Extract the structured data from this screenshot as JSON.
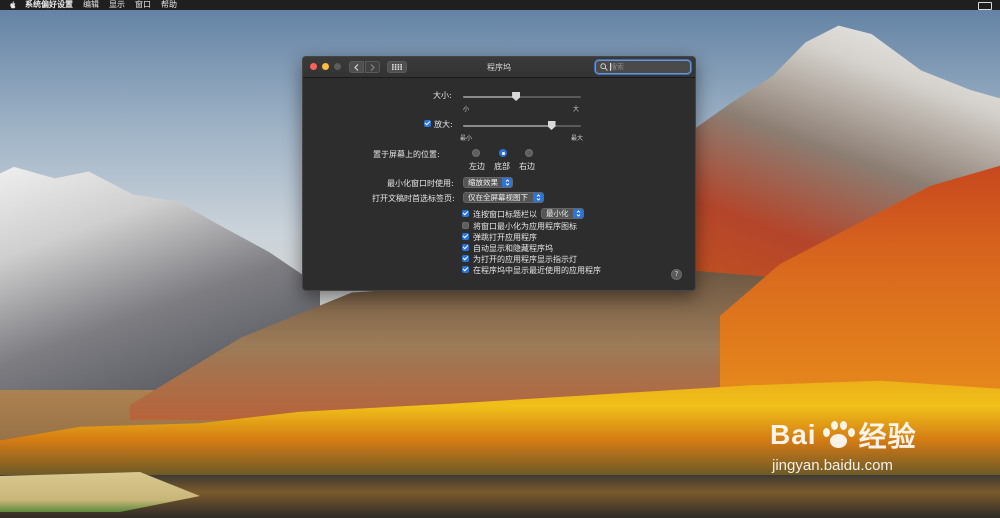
{
  "menubar": {
    "app": "系统偏好设置",
    "items": [
      "编辑",
      "显示",
      "窗口",
      "帮助"
    ]
  },
  "window": {
    "title": "程序坞",
    "search_placeholder": "搜索"
  },
  "dock": {
    "size_label": "大小:",
    "size_min": "小",
    "size_max": "大",
    "size_value": 0.45,
    "magnify_label": "放大:",
    "magnify_checked": true,
    "magnify_min": "最小",
    "magnify_max": "最大",
    "magnify_value": 0.75,
    "position_label": "置于屏幕上的位置:",
    "positions": [
      {
        "label": "左边",
        "selected": false
      },
      {
        "label": "底部",
        "selected": true
      },
      {
        "label": "右边",
        "selected": false
      }
    ],
    "minimize_label": "最小化窗口时使用:",
    "minimize_value": "缩放效果",
    "tabs_label": "打开文稿时首选标签页:",
    "tabs_value": "仅在全屏幕视图下",
    "options": [
      {
        "label": "连按窗口标题栏以",
        "checked": true,
        "select": "最小化"
      },
      {
        "label": "将窗口最小化为应用程序图标",
        "checked": false
      },
      {
        "label": "弹跳打开应用程序",
        "checked": true
      },
      {
        "label": "自动显示和隐藏程序坞",
        "checked": true
      },
      {
        "label": "为打开的应用程序显示指示灯",
        "checked": true
      },
      {
        "label": "在程序坞中显示最近使用的应用程序",
        "checked": true
      }
    ],
    "help": "?"
  },
  "watermark": {
    "logo": "Bai  经验",
    "url": "jingyan.baidu.com"
  },
  "colors": {
    "accent": "#2c74d8",
    "window_bg": "#2d2d2d",
    "menubar_bg": "#1f1f1f"
  }
}
